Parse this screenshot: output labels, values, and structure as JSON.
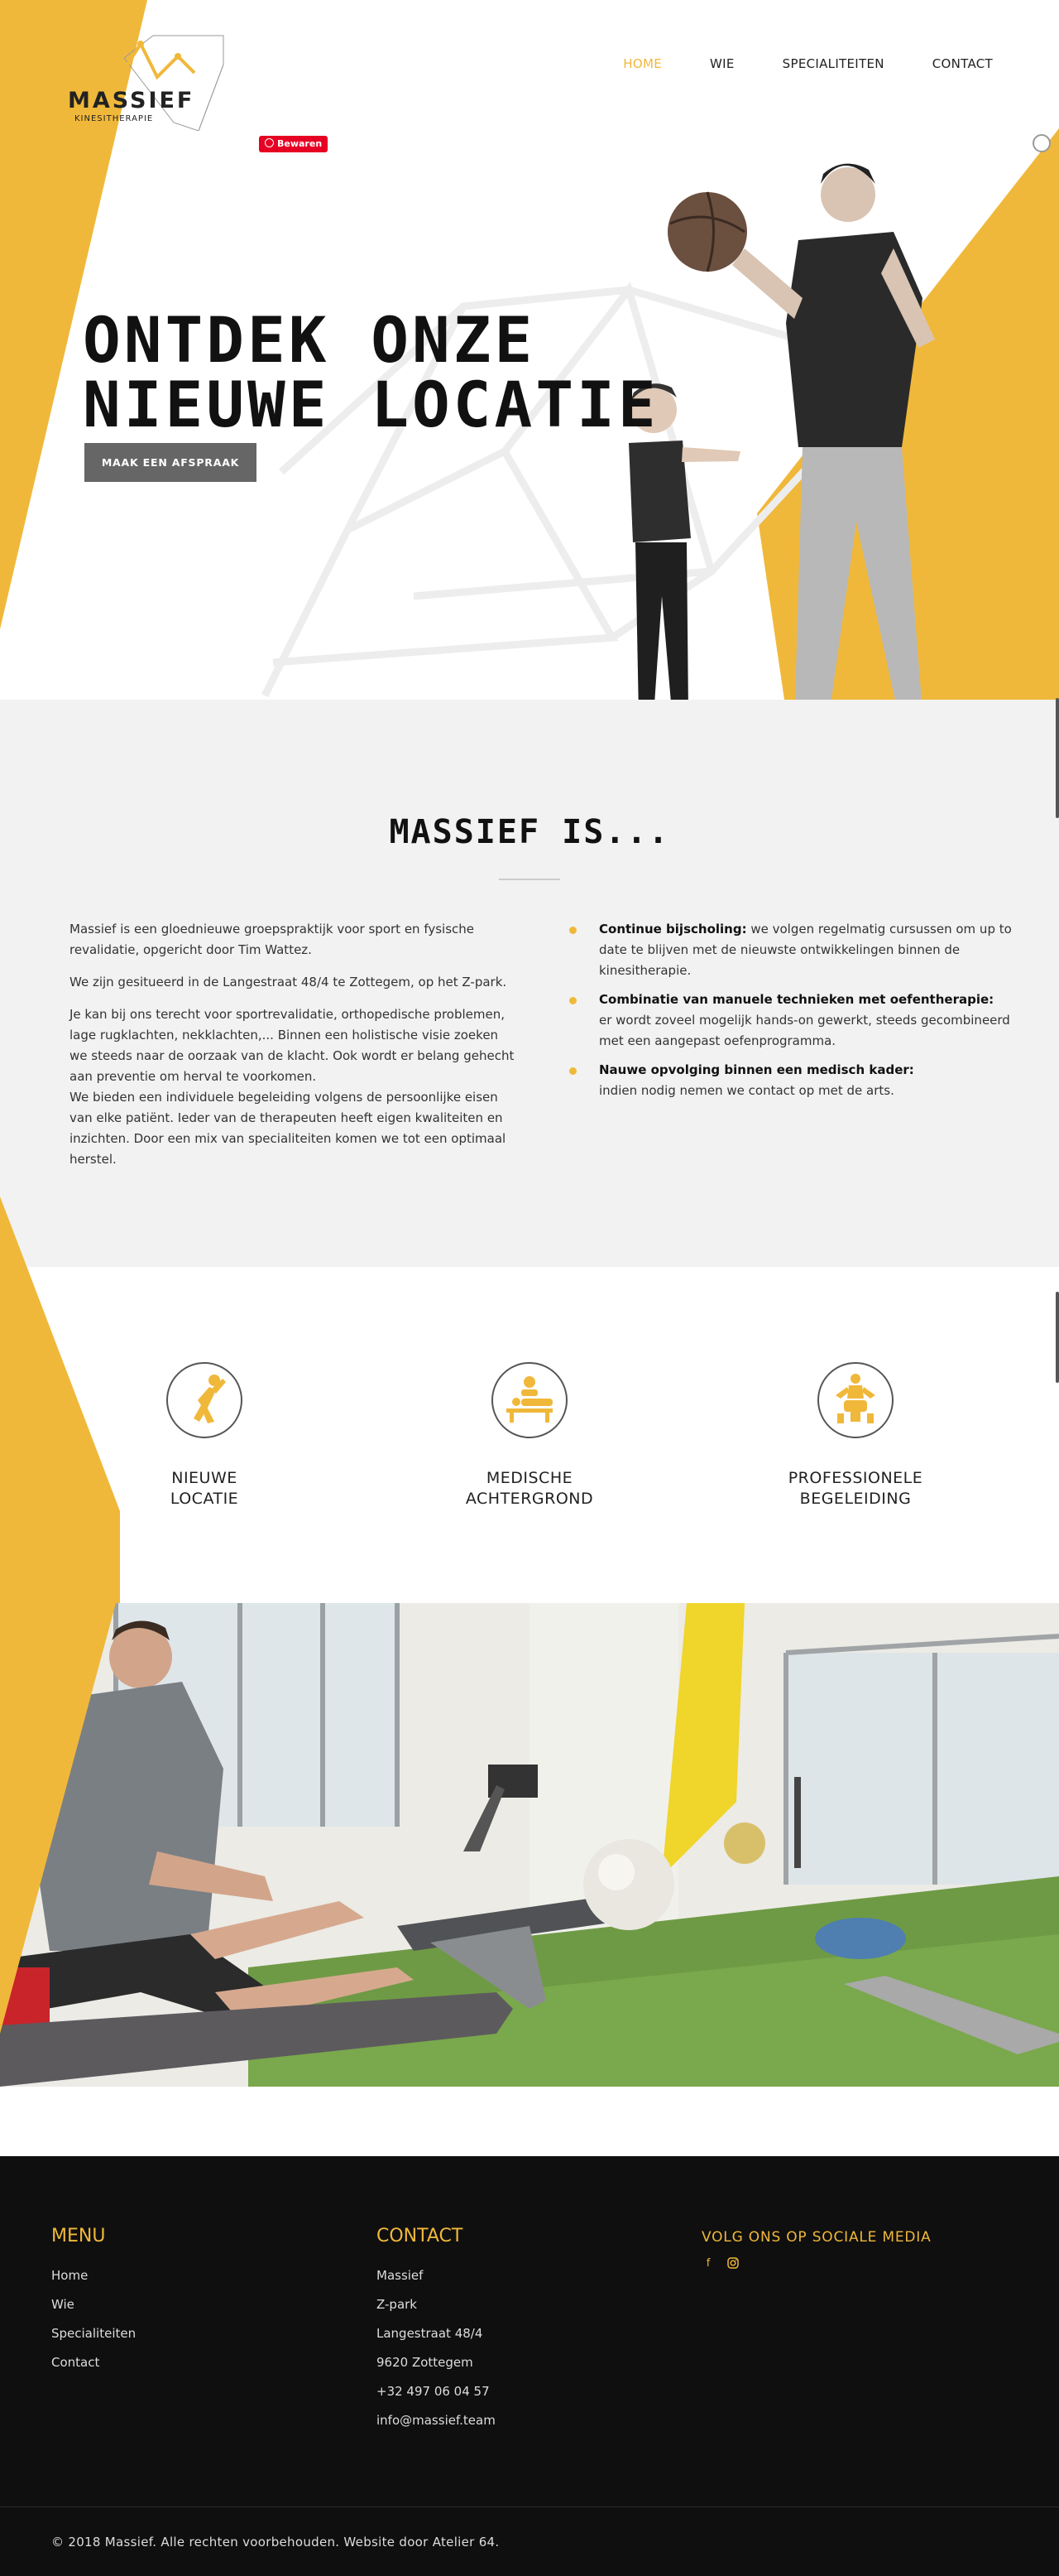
{
  "colors": {
    "accent": "#f0b83a",
    "dark": "#0f0f0f",
    "light_bg": "#f2f2f2",
    "button_gray": "#666666",
    "pinterest": "#e60023"
  },
  "logo": {
    "name": "MASSIEF",
    "tagline": "KINESITHERAPIE"
  },
  "nav": {
    "items": [
      "HOME",
      "WIE",
      "SPECIALITEITEN",
      "CONTACT"
    ],
    "active": "HOME"
  },
  "pinterest_badge": {
    "label": "Bewaren"
  },
  "hero": {
    "title_line1": "ONTDEK ONZE",
    "title_line2": "NIEUWE LOCATIE",
    "button_label": "MAAK EEN AFSPRAAK"
  },
  "about": {
    "title": "MASSIEF IS...",
    "paragraphs": [
      "Massief is een gloednieuwe groepspraktijk voor sport en fysische revalidatie, opgericht door Tim Wattez.",
      "We zijn gesitueerd in de Langestraat 48/4 te Zottegem, op het Z-park.",
      "Je kan bij ons terecht voor sportrevalidatie, orthopedische problemen, lage rugklachten, nekklachten,... Binnen een holistische visie zoeken we steeds naar de oorzaak van de klacht. Ook wordt er belang gehecht aan preventie om herval te voorkomen.",
      "We bieden een individuele begeleiding volgens de persoonlijke eisen van elke patiënt. Ieder van de therapeuten heeft eigen kwaliteiten en inzichten. Door een mix van specialiteiten komen we tot een optimaal herstel."
    ],
    "bullets": [
      {
        "bold": "Continue bijscholing:",
        "text": " we volgen regelmatig cursussen om up to date te blijven met de nieuwste ontwikkelingen binnen de kinesitherapie."
      },
      {
        "bold": "Combinatie van manuele technieken met oefentherapie:",
        "text": " er wordt zoveel mogelijk hands-on gewerkt, steeds gecombineerd met een aangepast oefenprogramma."
      },
      {
        "bold": "Nauwe opvolging binnen een medisch kader:",
        "text": " indien nodig nemen we contact op met de arts."
      }
    ]
  },
  "features": [
    {
      "icon": "stretching-person-icon",
      "line1": "NIEUWE",
      "line2": "LOCATIE"
    },
    {
      "icon": "massage-table-icon",
      "line1": "MEDISCHE",
      "line2": "ACHTERGROND"
    },
    {
      "icon": "coaching-person-icon",
      "line1": "PROFESSIONELE",
      "line2": "BEGELEIDING"
    }
  ],
  "footer": {
    "menu_title": "MENU",
    "menu_items": [
      "Home",
      "Wie",
      "Specialiteiten",
      "Contact"
    ],
    "contact_title": "CONTACT",
    "contact_lines": [
      "Massief",
      "Z-park",
      "Langestraat 48/4",
      "9620 Zottegem",
      "+32 497 06 04 57",
      "info@massief.team"
    ],
    "social_title": "VOLG ONS OP SOCIALE MEDIA",
    "social_icons": [
      "facebook-icon",
      "instagram-icon"
    ],
    "copyright": "© 2018 Massief. Alle rechten voorbehouden. Website door Atelier 64."
  }
}
